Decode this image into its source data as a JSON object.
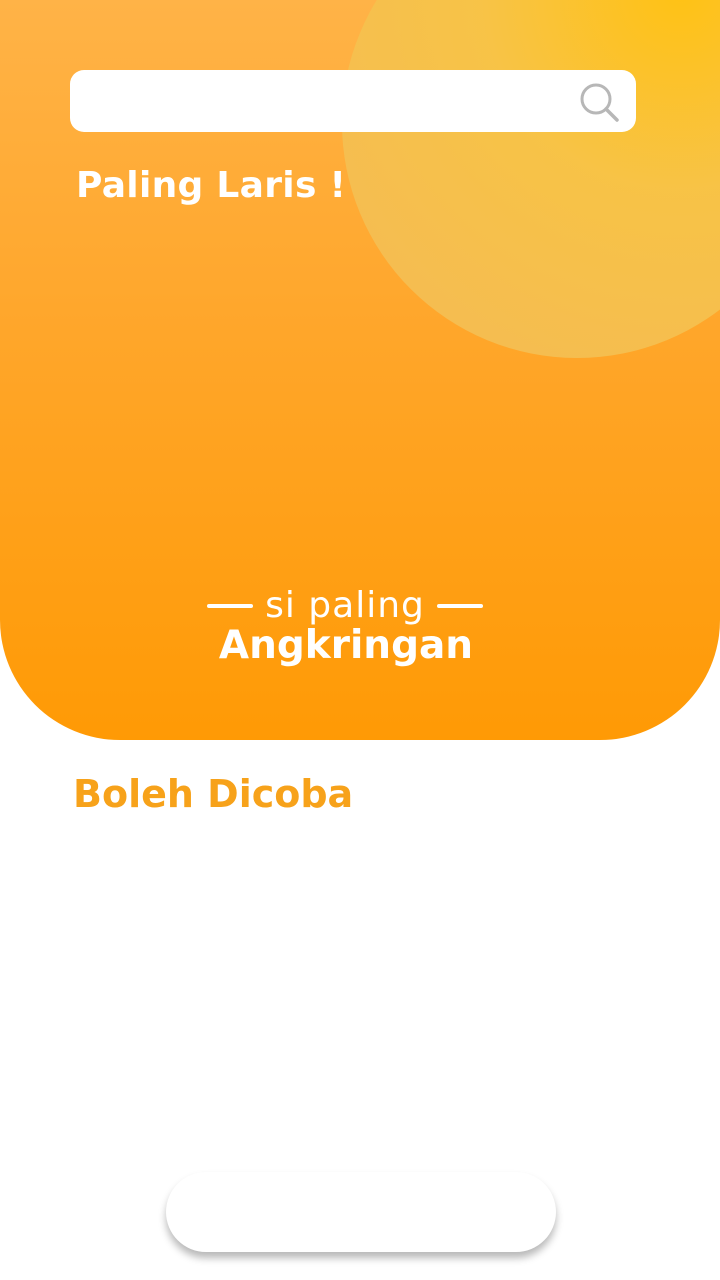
{
  "search": {
    "placeholder": "",
    "value": "",
    "icon": "search-icon"
  },
  "sections": {
    "top_title": "Paling Laris !",
    "bottom_title": "Boleh Dicoba"
  },
  "tagline": {
    "small": "si paling",
    "big": "Angkringan"
  },
  "colors": {
    "accent": "#f7a21a",
    "hero_top": "#ffb347",
    "hero_bottom": "#ff9a05",
    "circle": "#ffc312",
    "text_on_accent": "#ffffff"
  }
}
